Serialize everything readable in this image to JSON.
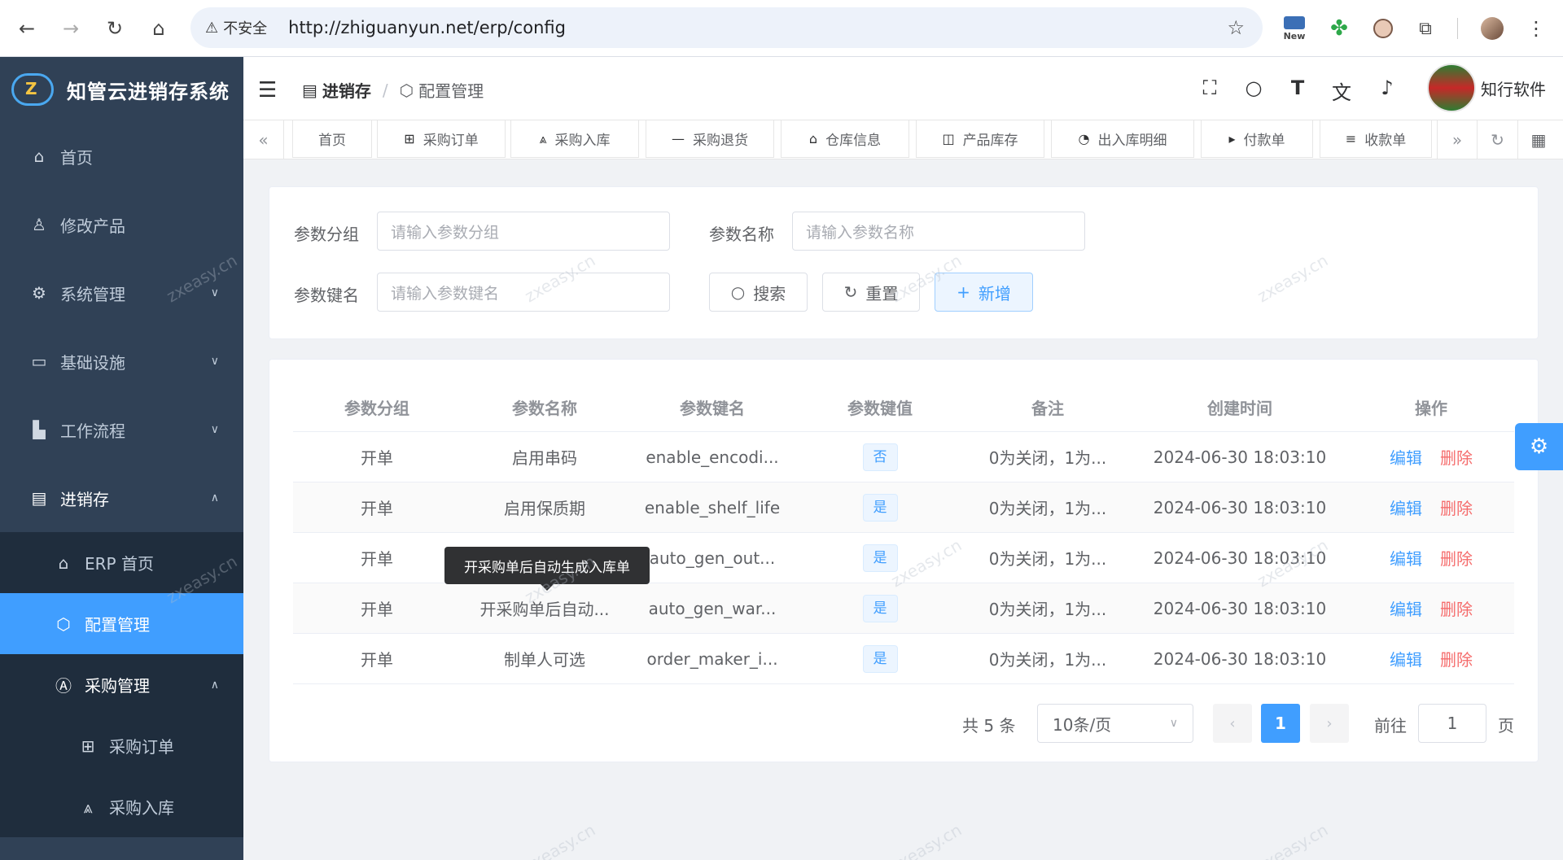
{
  "browser": {
    "security_label": "不安全",
    "url": "http://zhiguanyun.net/erp/config",
    "ext_new_label": "New"
  },
  "app": {
    "title": "知管云进销存系统"
  },
  "sidebar": {
    "items": [
      {
        "label": "首页",
        "icon": "home-icon"
      },
      {
        "label": "修改产品",
        "icon": "user-icon"
      },
      {
        "label": "系统管理",
        "icon": "gear-icon"
      },
      {
        "label": "基础设施",
        "icon": "monitor-icon"
      },
      {
        "label": "工作流程",
        "icon": "map-icon"
      },
      {
        "label": "进销存",
        "icon": "store-icon"
      }
    ],
    "sub_items": [
      {
        "label": "ERP 首页",
        "icon": "home-icon"
      },
      {
        "label": "配置管理",
        "icon": "config-icon"
      },
      {
        "label": "采购管理",
        "icon": "a-box-icon"
      }
    ],
    "sub2_items": [
      {
        "label": "采购订单",
        "icon": "grid-icon"
      },
      {
        "label": "采购入库",
        "icon": "road-icon"
      }
    ]
  },
  "header": {
    "breadcrumb_parent": "进销存",
    "breadcrumb_current": "配置管理",
    "user_name": "知行软件"
  },
  "tabs": [
    {
      "label": "首页",
      "icon": ""
    },
    {
      "label": "采购订单",
      "icon": "grid-icon"
    },
    {
      "label": "采购入库",
      "icon": "road-icon"
    },
    {
      "label": "采购退货",
      "icon": "minus-icon"
    },
    {
      "label": "仓库信息",
      "icon": "house-icon"
    },
    {
      "label": "产品库存",
      "icon": "cup-icon"
    },
    {
      "label": "出入库明细",
      "icon": "chart-icon"
    },
    {
      "label": "付款单",
      "icon": "play-icon"
    },
    {
      "label": "收款单",
      "icon": "list-icon"
    }
  ],
  "search": {
    "group_label": "参数分组",
    "group_placeholder": "请输入参数分组",
    "name_label": "参数名称",
    "name_placeholder": "请输入参数名称",
    "key_label": "参数键名",
    "key_placeholder": "请输入参数键名",
    "search_btn": "搜索",
    "reset_btn": "重置",
    "add_btn": "新增"
  },
  "table": {
    "columns": [
      "参数分组",
      "参数名称",
      "参数键名",
      "参数键值",
      "备注",
      "创建时间",
      "操作"
    ],
    "rows": [
      {
        "group": "开单",
        "name": "启用串码",
        "key": "enable_encodi...",
        "value": "否",
        "remark": "0为关闭，1为...",
        "created": "2024-06-30 18:03:10"
      },
      {
        "group": "开单",
        "name": "启用保质期",
        "key": "enable_shelf_life",
        "value": "是",
        "remark": "0为关闭，1为...",
        "created": "2024-06-30 18:03:10"
      },
      {
        "group": "开单",
        "name": "",
        "key": "auto_gen_out...",
        "value": "是",
        "remark": "0为关闭，1为...",
        "created": "2024-06-30 18:03:10"
      },
      {
        "group": "开单",
        "name": "开采购单后自动...",
        "key": "auto_gen_war...",
        "value": "是",
        "remark": "0为关闭，1为...",
        "created": "2024-06-30 18:03:10"
      },
      {
        "group": "开单",
        "name": "制单人可选",
        "key": "order_maker_i...",
        "value": "是",
        "remark": "0为关闭，1为...",
        "created": "2024-06-30 18:03:10"
      }
    ],
    "edit_label": "编辑",
    "delete_label": "删除",
    "tooltip": "开采购单后自动生成入库单"
  },
  "pagination": {
    "total": "共 5 条",
    "page_size": "10条/页",
    "current_page": "1",
    "goto_label": "前往",
    "goto_value": "1",
    "page_suffix": "页"
  },
  "watermark": "zxeasy.cn"
}
